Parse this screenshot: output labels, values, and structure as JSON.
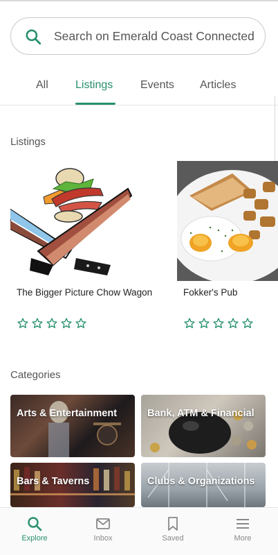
{
  "search": {
    "placeholder": "Search on Emerald Coast Connected"
  },
  "tabs": [
    {
      "label": "All",
      "active": false
    },
    {
      "label": "Listings",
      "active": true
    },
    {
      "label": "Events",
      "active": false
    },
    {
      "label": "Articles",
      "active": false
    }
  ],
  "listings": {
    "title": "Listings",
    "items": [
      {
        "name": "The Bigger Picture Chow Wagon",
        "rating": 0,
        "max_rating": 5
      },
      {
        "name": "Fokker's Pub",
        "rating": 0,
        "max_rating": 5
      }
    ]
  },
  "categories": {
    "title": "Categories",
    "items": [
      {
        "label": "Arts & Entertainment"
      },
      {
        "label": "Bank, ATM & Financial"
      },
      {
        "label": "Bars & Taverns"
      },
      {
        "label": "Clubs & Organizations"
      }
    ]
  },
  "bottom_nav": [
    {
      "label": "Explore",
      "icon": "search-icon",
      "active": true
    },
    {
      "label": "Inbox",
      "icon": "mail-icon",
      "active": false
    },
    {
      "label": "Saved",
      "icon": "bookmark-icon",
      "active": false
    },
    {
      "label": "More",
      "icon": "menu-icon",
      "active": false
    }
  ],
  "colors": {
    "accent": "#27906c",
    "star": "#27906c",
    "text": "#555555"
  }
}
